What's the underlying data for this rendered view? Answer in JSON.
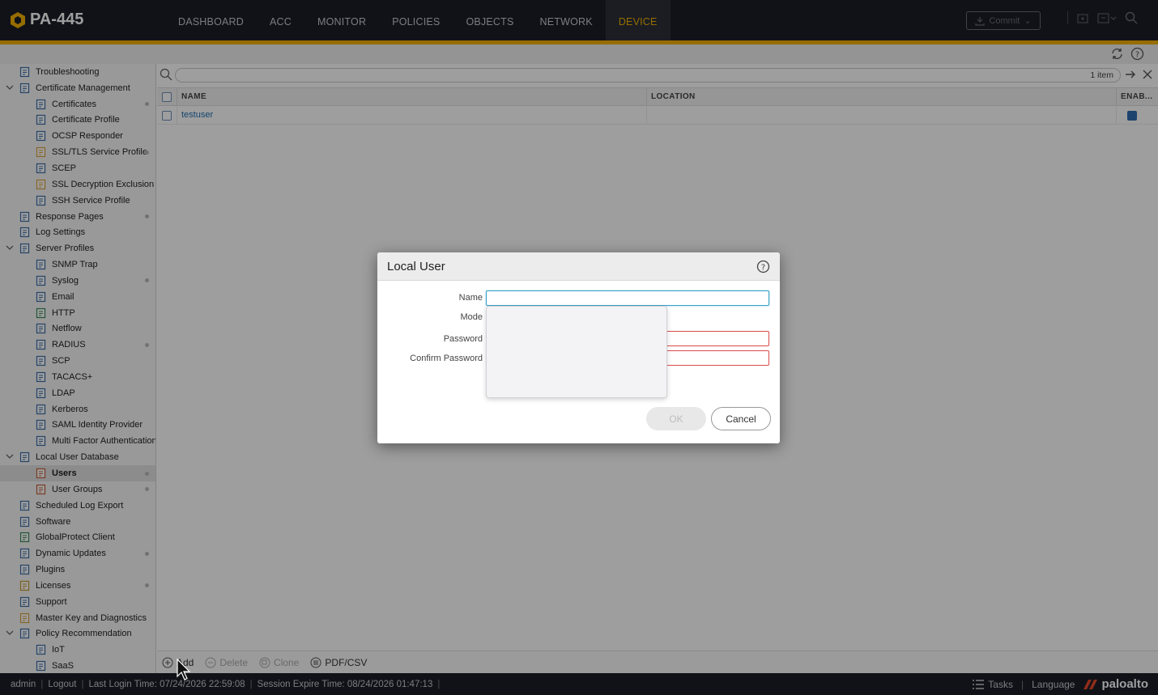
{
  "app": {
    "device_name": "PA-445"
  },
  "nav": {
    "items": [
      "DASHBOARD",
      "ACC",
      "MONITOR",
      "POLICIES",
      "OBJECTS",
      "NETWORK",
      "DEVICE"
    ],
    "active": "DEVICE",
    "commit_label": "Commit"
  },
  "sidebar": {
    "items": [
      {
        "label": "Troubleshooting",
        "level": 1,
        "icon": "wrench-icon"
      },
      {
        "label": "Certificate Management",
        "level": 1,
        "icon": "certificate-icon",
        "expanded": true
      },
      {
        "label": "Certificates",
        "level": 2,
        "icon": "certificate-icon",
        "dot": true
      },
      {
        "label": "Certificate Profile",
        "level": 2,
        "icon": "certificate-icon"
      },
      {
        "label": "OCSP Responder",
        "level": 2,
        "icon": "certificate-icon"
      },
      {
        "label": "SSL/TLS Service Profile",
        "level": 2,
        "icon": "lock-icon",
        "dot": true
      },
      {
        "label": "SCEP",
        "level": 2,
        "icon": "scep-icon"
      },
      {
        "label": "SSL Decryption Exclusion",
        "level": 2,
        "icon": "lock-icon"
      },
      {
        "label": "SSH Service Profile",
        "level": 2,
        "icon": "certificate-icon"
      },
      {
        "label": "Response Pages",
        "level": 1,
        "icon": "page-icon",
        "dot": true
      },
      {
        "label": "Log Settings",
        "level": 1,
        "icon": "log-icon"
      },
      {
        "label": "Server Profiles",
        "level": 1,
        "icon": "server-icon",
        "expanded": true
      },
      {
        "label": "SNMP Trap",
        "level": 2,
        "icon": "profile-icon"
      },
      {
        "label": "Syslog",
        "level": 2,
        "icon": "profile-icon",
        "dot": true
      },
      {
        "label": "Email",
        "level": 2,
        "icon": "email-icon"
      },
      {
        "label": "HTTP",
        "level": 2,
        "icon": "http-icon"
      },
      {
        "label": "Netflow",
        "level": 2,
        "icon": "profile-icon"
      },
      {
        "label": "RADIUS",
        "level": 2,
        "icon": "profile-icon",
        "dot": true
      },
      {
        "label": "SCP",
        "level": 2,
        "icon": "profile-icon"
      },
      {
        "label": "TACACS+",
        "level": 2,
        "icon": "profile-icon"
      },
      {
        "label": "LDAP",
        "level": 2,
        "icon": "profile-icon"
      },
      {
        "label": "Kerberos",
        "level": 2,
        "icon": "profile-icon"
      },
      {
        "label": "SAML Identity Provider",
        "level": 2,
        "icon": "profile-icon"
      },
      {
        "label": "Multi Factor Authentication",
        "level": 2,
        "icon": "profile-icon"
      },
      {
        "label": "Local User Database",
        "level": 1,
        "icon": "database-icon",
        "expanded": true
      },
      {
        "label": "Users",
        "level": 2,
        "icon": "user-icon",
        "dot": true,
        "selected": true
      },
      {
        "label": "User Groups",
        "level": 2,
        "icon": "user-group-icon",
        "dot": true
      },
      {
        "label": "Scheduled Log Export",
        "level": 1,
        "icon": "log-icon"
      },
      {
        "label": "Software",
        "level": 1,
        "icon": "software-icon"
      },
      {
        "label": "GlobalProtect Client",
        "level": 1,
        "icon": "globe-icon"
      },
      {
        "label": "Dynamic Updates",
        "level": 1,
        "icon": "update-icon",
        "dot": true
      },
      {
        "label": "Plugins",
        "level": 1,
        "icon": "plugin-icon"
      },
      {
        "label": "Licenses",
        "level": 1,
        "icon": "key-icon",
        "dot": true
      },
      {
        "label": "Support",
        "level": 1,
        "icon": "support-icon"
      },
      {
        "label": "Master Key and Diagnostics",
        "level": 1,
        "icon": "lock-icon"
      },
      {
        "label": "Policy Recommendation",
        "level": 1,
        "icon": "policy-icon",
        "expanded": true
      },
      {
        "label": "IoT",
        "level": 2,
        "icon": "iot-icon"
      },
      {
        "label": "SaaS",
        "level": 2,
        "icon": "saas-icon"
      }
    ]
  },
  "main": {
    "item_count": "1 item",
    "columns": [
      "NAME",
      "LOCATION",
      "ENAB..."
    ],
    "rows": [
      {
        "name": "testuser",
        "location": "",
        "enabled": true
      }
    ],
    "actions": {
      "add": "Add",
      "delete": "Delete",
      "clone": "Clone",
      "export": "PDF/CSV"
    }
  },
  "dialog": {
    "title": "Local User",
    "fields": {
      "name_label": "Name",
      "mode_label": "Mode",
      "password_label": "Password",
      "confirm_label": "Confirm Password"
    },
    "ok_label": "OK",
    "cancel_label": "Cancel"
  },
  "status": {
    "user": "admin",
    "logout": "Logout",
    "last_login": "Last Login Time: 07/24/2026 22:59:08",
    "session_expire": "Session Expire Time: 08/24/2026 01:47:13",
    "tasks": "Tasks",
    "language": "Language",
    "brand": "paloalto"
  }
}
